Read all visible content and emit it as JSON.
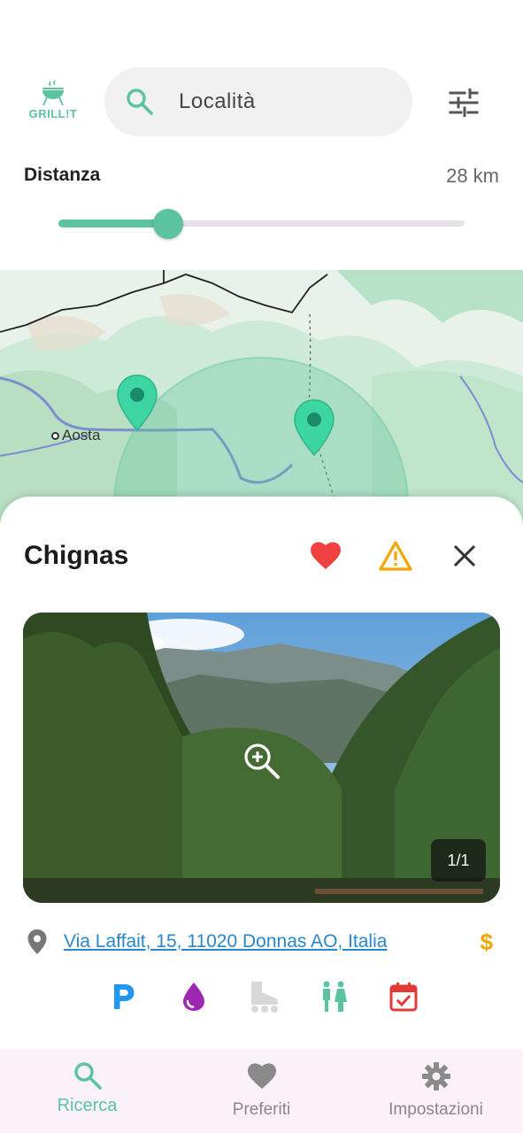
{
  "app": {
    "logo_text": "GRILL!T"
  },
  "search": {
    "placeholder": "Località"
  },
  "distance": {
    "label": "Distanza",
    "value_text": "28 km",
    "fraction": 0.27
  },
  "map": {
    "city_label": "Aosta",
    "accent": "#5cc3a0"
  },
  "sheet": {
    "title": "Chignas",
    "favorite_icon": "heart-icon",
    "report_icon": "warning-icon",
    "close_icon": "close-icon",
    "photo_counter": "1/1",
    "address": "Via Laffait, 15, 11020 Donnas AO, Italia",
    "price_symbol": "$",
    "amenities": [
      {
        "name": "parking-icon",
        "color": "#2196f3",
        "enabled": true
      },
      {
        "name": "water-drop-icon",
        "color": "#9c27b0",
        "enabled": true
      },
      {
        "name": "rollerskate-icon",
        "color": "#d6d6d6",
        "enabled": false
      },
      {
        "name": "restroom-icon",
        "color": "#5cc3a0",
        "enabled": true
      },
      {
        "name": "calendar-icon",
        "color": "#e53935",
        "enabled": true
      }
    ]
  },
  "colors": {
    "accent": "#5cc3a0",
    "heart": "#f04040",
    "warning": "#f0a500",
    "link": "#2a86c9",
    "nav_bg": "#fbf1f8"
  },
  "nav": {
    "items": [
      {
        "label": "Ricerca",
        "icon": "search-icon",
        "active": true
      },
      {
        "label": "Preferiti",
        "icon": "heart-icon",
        "active": false
      },
      {
        "label": "Impostazioni",
        "icon": "gear-icon",
        "active": false
      }
    ]
  }
}
